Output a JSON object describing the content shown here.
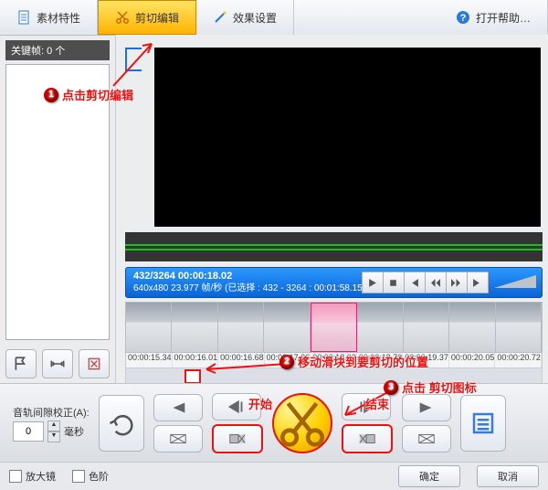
{
  "tabs": {
    "material": "素材特性",
    "cut": "剪切编辑",
    "effect": "效果设置",
    "help": "打开帮助…"
  },
  "left": {
    "keyframes": "关键帧: 0 个"
  },
  "info": {
    "line1": "432/3264  00:00:18.02",
    "line2": "640x480 23.977  帧/秒  (已选择 : 432 - 3264 : 00:01:58.15)"
  },
  "ruler": [
    "00:00:15.34",
    "00:00:16.01",
    "00:00:16.68",
    "00:00:17.36",
    "00:00:18.03",
    "00:00:18.70",
    "00:00:19.37",
    "00:00:20.05",
    "00:00:20.72"
  ],
  "bottom": {
    "trackfix": "音轨间隙校正(A):",
    "unit": "毫秒",
    "value": "0",
    "start": "开始",
    "end": "结束"
  },
  "footer": {
    "magnifier": "放大镜",
    "levels": "色阶",
    "ok": "确定",
    "cancel": "取消"
  },
  "ann": {
    "a1": "点击剪切编辑",
    "a2": "移动滑块到要剪切的位置",
    "a3": "点击 剪切图标"
  },
  "icons": {
    "scissors": "scissors-icon",
    "page": "page-icon",
    "wand": "wand-icon"
  }
}
